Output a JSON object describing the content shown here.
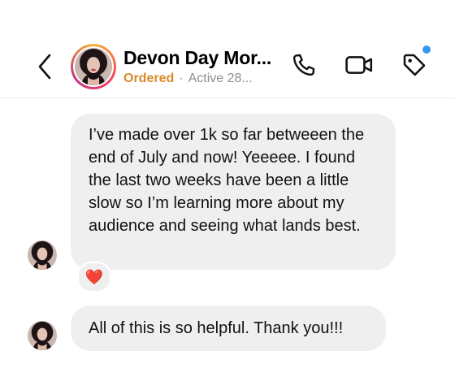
{
  "header": {
    "contact_name": "Devon Day Mor...",
    "status": "Ordered",
    "separator": "·",
    "activity": "Active 28...",
    "icons": [
      "back-chevron-icon",
      "phone-icon",
      "video-camera-icon",
      "tag-icon"
    ],
    "accent_colors": {
      "status": "#d98a2b",
      "notification_dot": "#3897f0"
    }
  },
  "messages": [
    {
      "text": "I’ve made over 1k so far betweeen the end of July and now! Yeeeee. I found the last two weeks have been a little slow so I’m learning more about my audience and seeing what lands best.",
      "reaction": "❤️"
    },
    {
      "text": "All of this is so helpful. Thank you!!!"
    }
  ]
}
